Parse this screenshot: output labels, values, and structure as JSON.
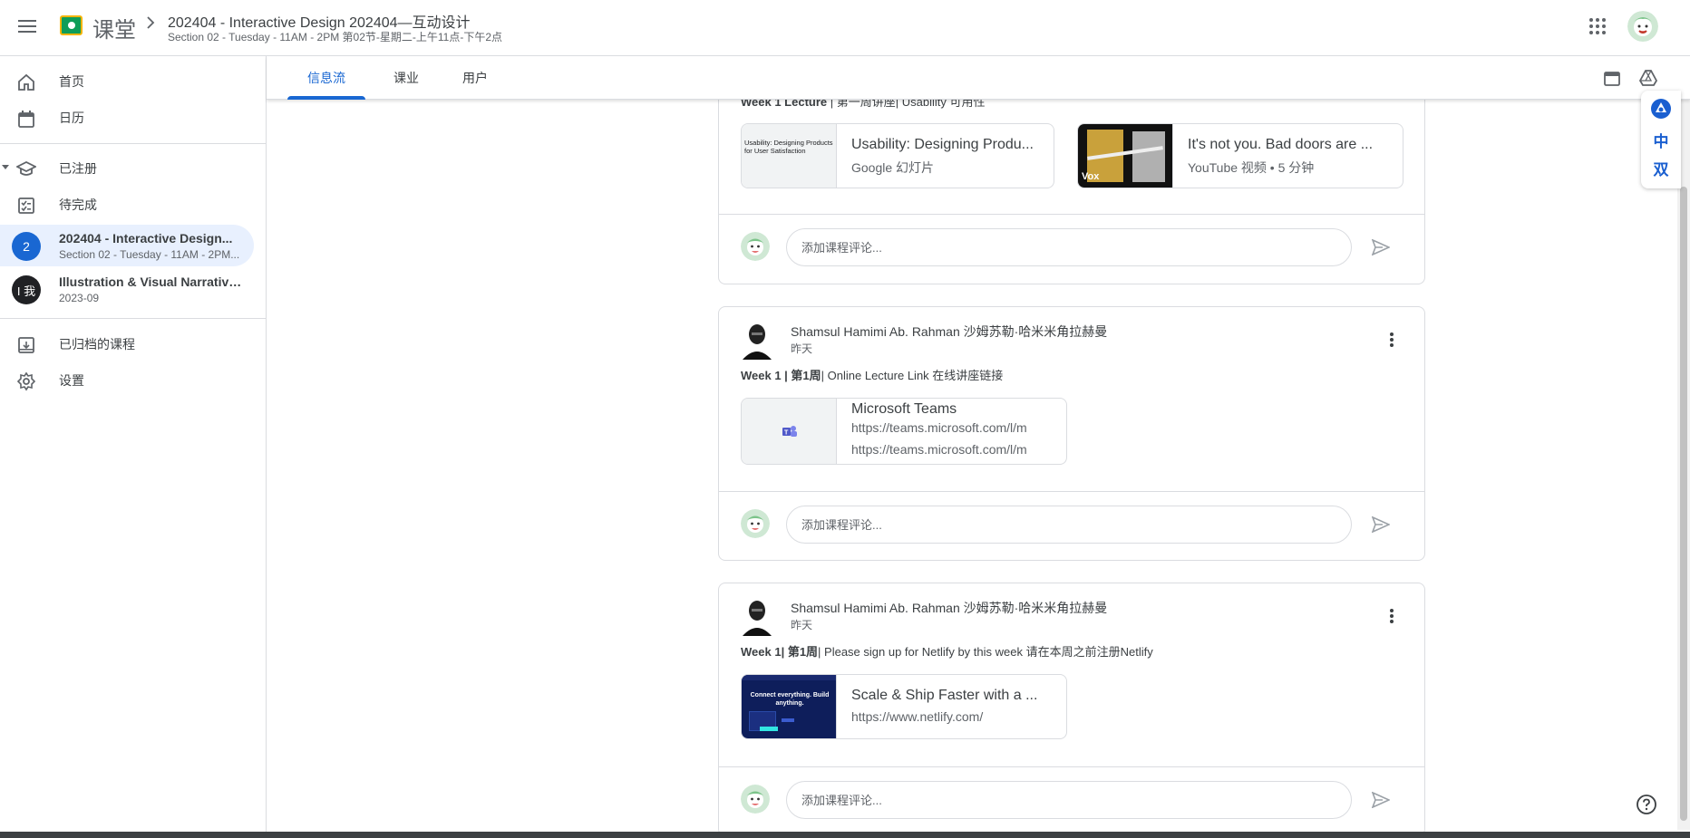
{
  "header": {
    "brand": "课堂",
    "course_title": "202404 - Interactive Design 202404—互动设计",
    "course_subtitle": "Section 02 - Tuesday - 11AM - 2PM 第02节-星期二-上午11点-下午2点",
    "icons": {
      "menu": "menu-icon",
      "apps": "apps-grid-icon",
      "chevron": "chevron-right-icon"
    }
  },
  "sidebar": {
    "home": "首页",
    "calendar": "日历",
    "enrolled": "已注册",
    "todo": "待完成",
    "courses": [
      {
        "badge": "2",
        "badge_color": "#1967d2",
        "title": "202404 - Interactive Design...",
        "subtitle": "Section 02 - Tuesday - 11AM - 2PM..."
      },
      {
        "badge": "I 我",
        "badge_color": "#202124",
        "title": "Illustration & Visual Narrative...",
        "subtitle": "2023-09"
      }
    ],
    "archived": "已归档的课程",
    "settings": "设置"
  },
  "tabs": [
    "信息流",
    "课业",
    "用户"
  ],
  "float_widget": {
    "zh": "中",
    "dual": "双"
  },
  "stream": {
    "partial_post": {
      "text_bold": "Week 1 Lecture",
      "text_rest": " | 第一周讲座| Usability 可用性",
      "attachments": [
        {
          "title": "Usability: Designing Produ...",
          "subtitle": "Google 幻灯片",
          "thumb_text": "Usability: Designing Products for User Satisfaction"
        },
        {
          "title": "It's not you. Bad doors are ...",
          "subtitle": "YouTube 视频 • 5 分钟",
          "thumb_text": "Vox"
        }
      ]
    },
    "posts": [
      {
        "author": "Shamsul Hamimi Ab. Rahman 沙姆苏勒·哈米米角拉赫曼",
        "time": "昨天",
        "text_bold": "Week 1 | 第1周",
        "text_rest": "| Online Lecture Link  在线讲座链接",
        "attachment": {
          "title": "Microsoft Teams",
          "line1": "https://teams.microsoft.com/l/m",
          "line2": "https://teams.microsoft.com/l/m"
        }
      },
      {
        "author": "Shamsul Hamimi Ab. Rahman 沙姆苏勒·哈米米角拉赫曼",
        "time": "昨天",
        "text_bold": "Week 1| 第1周",
        "text_rest": "| Please sign up for Netlify by this week  请在本周之前注册Netlify",
        "attachment": {
          "title": "Scale & Ship Faster with a ...",
          "line1": "https://www.netlify.com/",
          "thumb_text": "Connect everything. Build anything."
        }
      }
    ],
    "comment_placeholder": "添加课程评论..."
  },
  "colors": {
    "accent": "#1967d2",
    "active_bg": "#e8f0fe",
    "border": "#dadce0"
  }
}
